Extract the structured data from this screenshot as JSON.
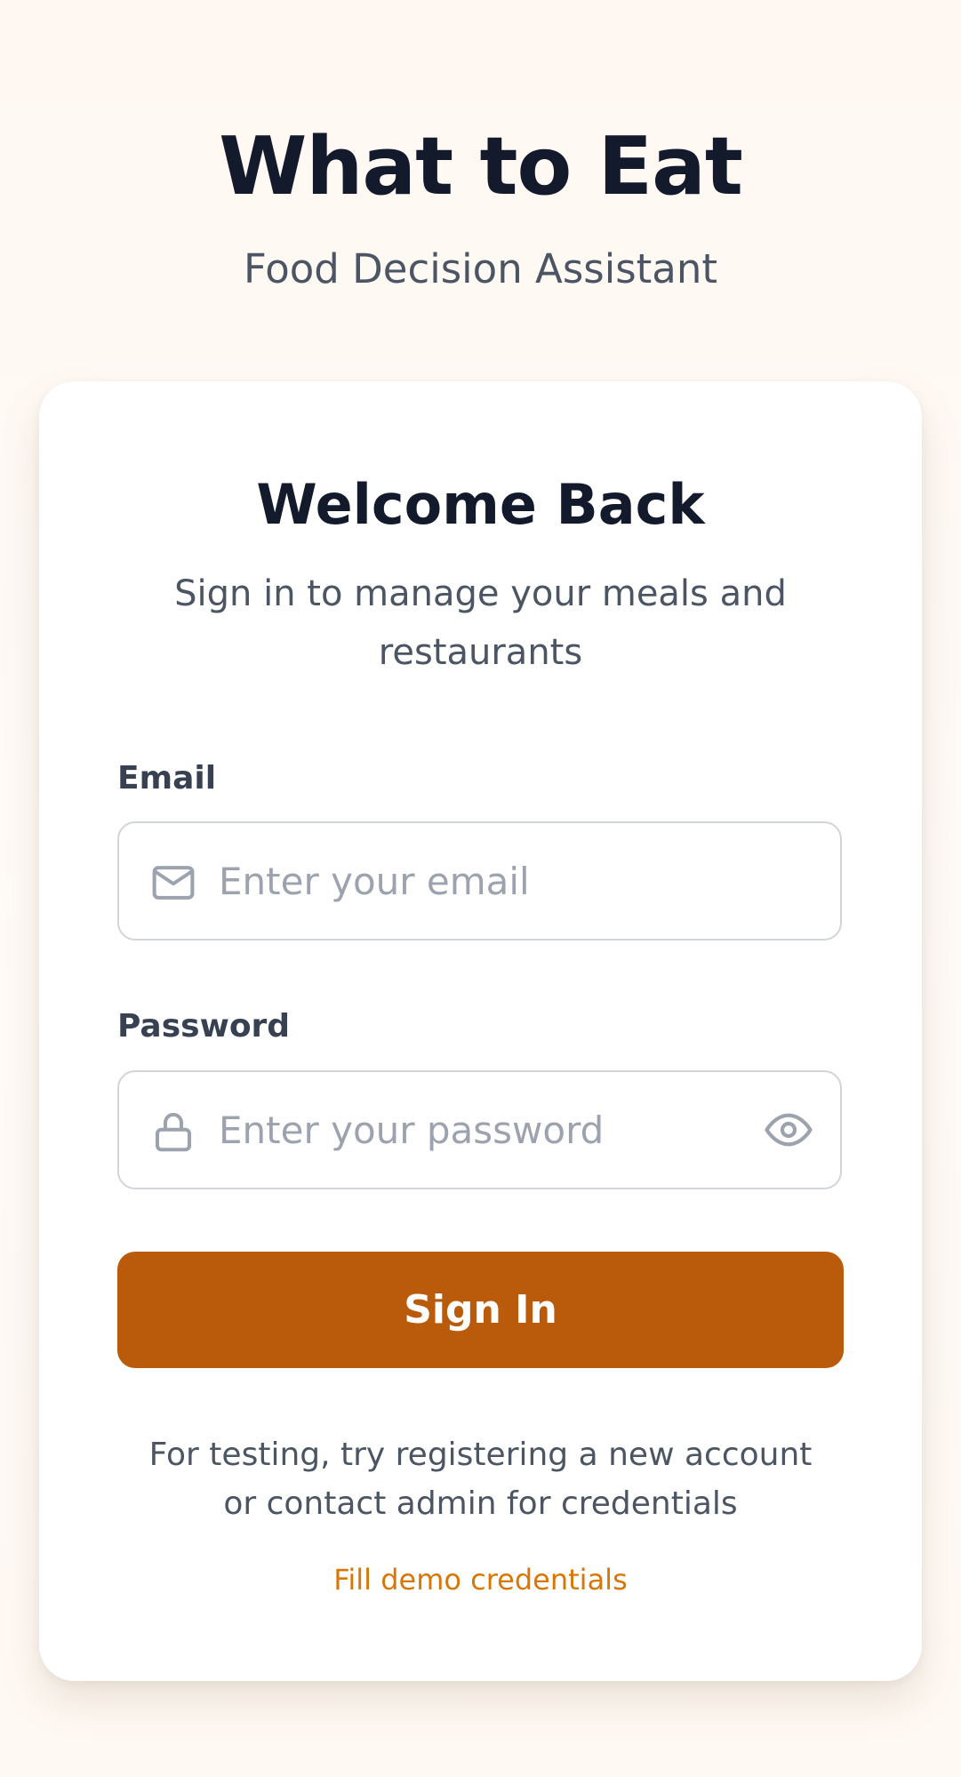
{
  "header": {
    "title": "What to Eat",
    "subtitle": "Food Decision Assistant"
  },
  "login": {
    "title": "Welcome Back",
    "subtitle": "Sign in to manage your meals and restaurants",
    "email": {
      "label": "Email",
      "placeholder": "Enter your email",
      "value": "",
      "icon": "mail-icon"
    },
    "password": {
      "label": "Password",
      "placeholder": "Enter your password",
      "value": "",
      "icon": "lock-icon",
      "toggle_icon": "eye-icon"
    },
    "submit_label": "Sign In",
    "helper_text": "For testing, try registering a new account or contact admin for credentials",
    "demo_link": "Fill demo credentials"
  },
  "colors": {
    "primary": "#b95b0a",
    "link": "#d97706",
    "heading": "#131a2b",
    "muted": "#4b5563",
    "placeholder": "#9ca3af",
    "border": "#d1d5db"
  }
}
